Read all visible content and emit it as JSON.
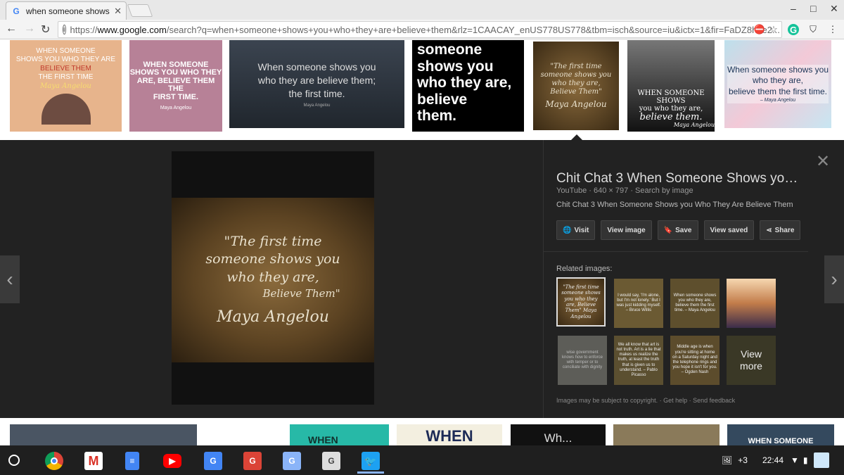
{
  "tab": {
    "title": "when someone shows yo",
    "icon": "google-g-icon"
  },
  "window": {
    "minimize": "–",
    "maximize": "□",
    "close": "✕"
  },
  "toolbar": {
    "url_scheme": "https://",
    "url_domain": "www.google.com",
    "url_path": "/search?q=when+someone+shows+you+who+they+are+believe+them&rlz=1CAACAY_enUS778US778&tbm=isch&source=iu&ictx=1&fir=FaDZ8h9e2...",
    "grammarly_letter": "G"
  },
  "top_thumbs": [
    {
      "lines": [
        "WHEN SOMEONE",
        "SHOWS YOU WHO THEY ARE",
        "BELIEVE THEM",
        "THE FIRST TIME",
        "Maya Angelou"
      ],
      "caption": ""
    },
    {
      "lines": [
        "WHEN SOMEONE",
        "SHOWS YOU WHO THEY",
        "ARE, BELIEVE THEM THE",
        "FIRST TIME."
      ],
      "caption": "Maya Angelou"
    },
    {
      "lines": [
        "When someone shows you",
        "who they are believe them;",
        "the first time."
      ],
      "caption": "Maya Angelou"
    },
    {
      "lines": [
        "someone",
        "shows you",
        "who they are,",
        "believe",
        "them."
      ],
      "caption": ""
    },
    {
      "lines": [
        "\"The first time",
        "someone shows you",
        "who they are,",
        "Believe Them\"",
        "Maya Angelou"
      ],
      "caption": ""
    },
    {
      "lines": [
        "WHEN SOMEONE SHOWS",
        "you who they are,",
        "believe them.",
        "Maya Angelou"
      ],
      "caption": ""
    },
    {
      "lines": [
        "When someone shows you",
        "who they are,",
        "believe them the first time.",
        "– Maya Angelou"
      ],
      "caption": ""
    }
  ],
  "preview": {
    "quote_lines": [
      "\"The first time",
      "someone shows you",
      "who they are,",
      "Believe Them\""
    ],
    "signature": "Maya Angelou"
  },
  "panel": {
    "title": "Chit Chat 3 When Someone Shows yo…",
    "source": "YouTube",
    "dimensions": "640 × 797",
    "search_by_image": "Search by image",
    "description": "Chit Chat 3 When Someone Shows you Who They Are Believe Them",
    "buttons": {
      "visit": "Visit",
      "view_image": "View image",
      "save": "Save",
      "view_saved": "View saved",
      "share": "Share"
    },
    "related_label": "Related images:",
    "related": [
      "\"The first time someone shows you who they are, Believe Them\" Maya Angelou",
      "I would say, 'I'm alone, but I'm not lonely.' But I was just kidding myself. – Bruce Willis",
      "When someone shows you who they are, believe them the first time. – Maya Angelou",
      "",
      "wise government knows how to enforce with temper or to conciliate with dignity",
      "We all know that art is not truth. Art is a lie that makes us realize the truth, at least the truth that is given us to understand. – Pablo Picasso",
      "Middle age is when you're sitting at home on a Saturday night and the telephone rings and you hope it isn't for you. – Ogden Nash",
      "View more"
    ],
    "footer_copyright": "Images may be subject to copyright.",
    "footer_help": "Get help",
    "footer_feedback": "Send feedback"
  },
  "bottom_thumbs": [
    "",
    "WHEN",
    "WHEN",
    "Wh...",
    "",
    "WHEN SOMEONE"
  ],
  "shelf": {
    "apps": [
      "Chrome",
      "Gmail",
      "Docs",
      "YouTube",
      "G",
      "G",
      "G",
      "G",
      "Twitter"
    ],
    "notification_count": "+3",
    "time": "22:44"
  }
}
